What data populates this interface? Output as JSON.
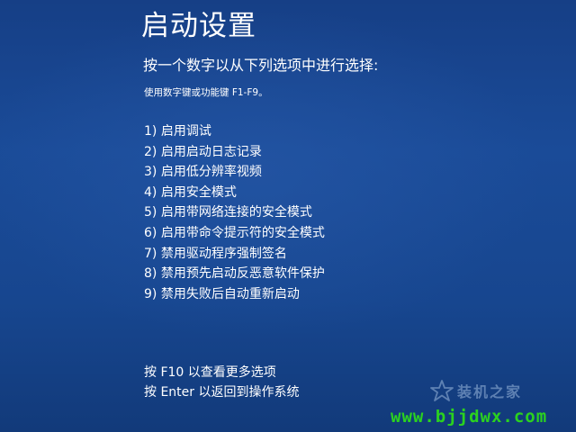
{
  "screen": {
    "title": "启动设置",
    "prompt": "按一个数字以从下列选项中进行选择:",
    "hint": "使用数字键或功能键 F1-F9。",
    "options": [
      {
        "label": "1) 启用调试"
      },
      {
        "label": "2) 启用启动日志记录"
      },
      {
        "label": "3) 启用低分辨率视频"
      },
      {
        "label": "4) 启用安全模式"
      },
      {
        "label": "5) 启用带网络连接的安全模式"
      },
      {
        "label": "6) 启用带命令提示符的安全模式"
      },
      {
        "label": "7) 禁用驱动程序强制签名"
      },
      {
        "label": "8) 禁用预先启动反恶意软件保护"
      },
      {
        "label": "9) 禁用失败后自动重新启动"
      }
    ],
    "footer": {
      "more_options": "按 F10 以查看更多选项",
      "return_os": "按 Enter 以返回到操作系统"
    }
  },
  "watermark": {
    "logo_text": "装机之家",
    "logo_icon": "star-icon",
    "url": "www.bjjdwx.com",
    "url_color": "#2bd21f"
  },
  "colors": {
    "background": "#1a4b98",
    "text": "#ffffff"
  }
}
